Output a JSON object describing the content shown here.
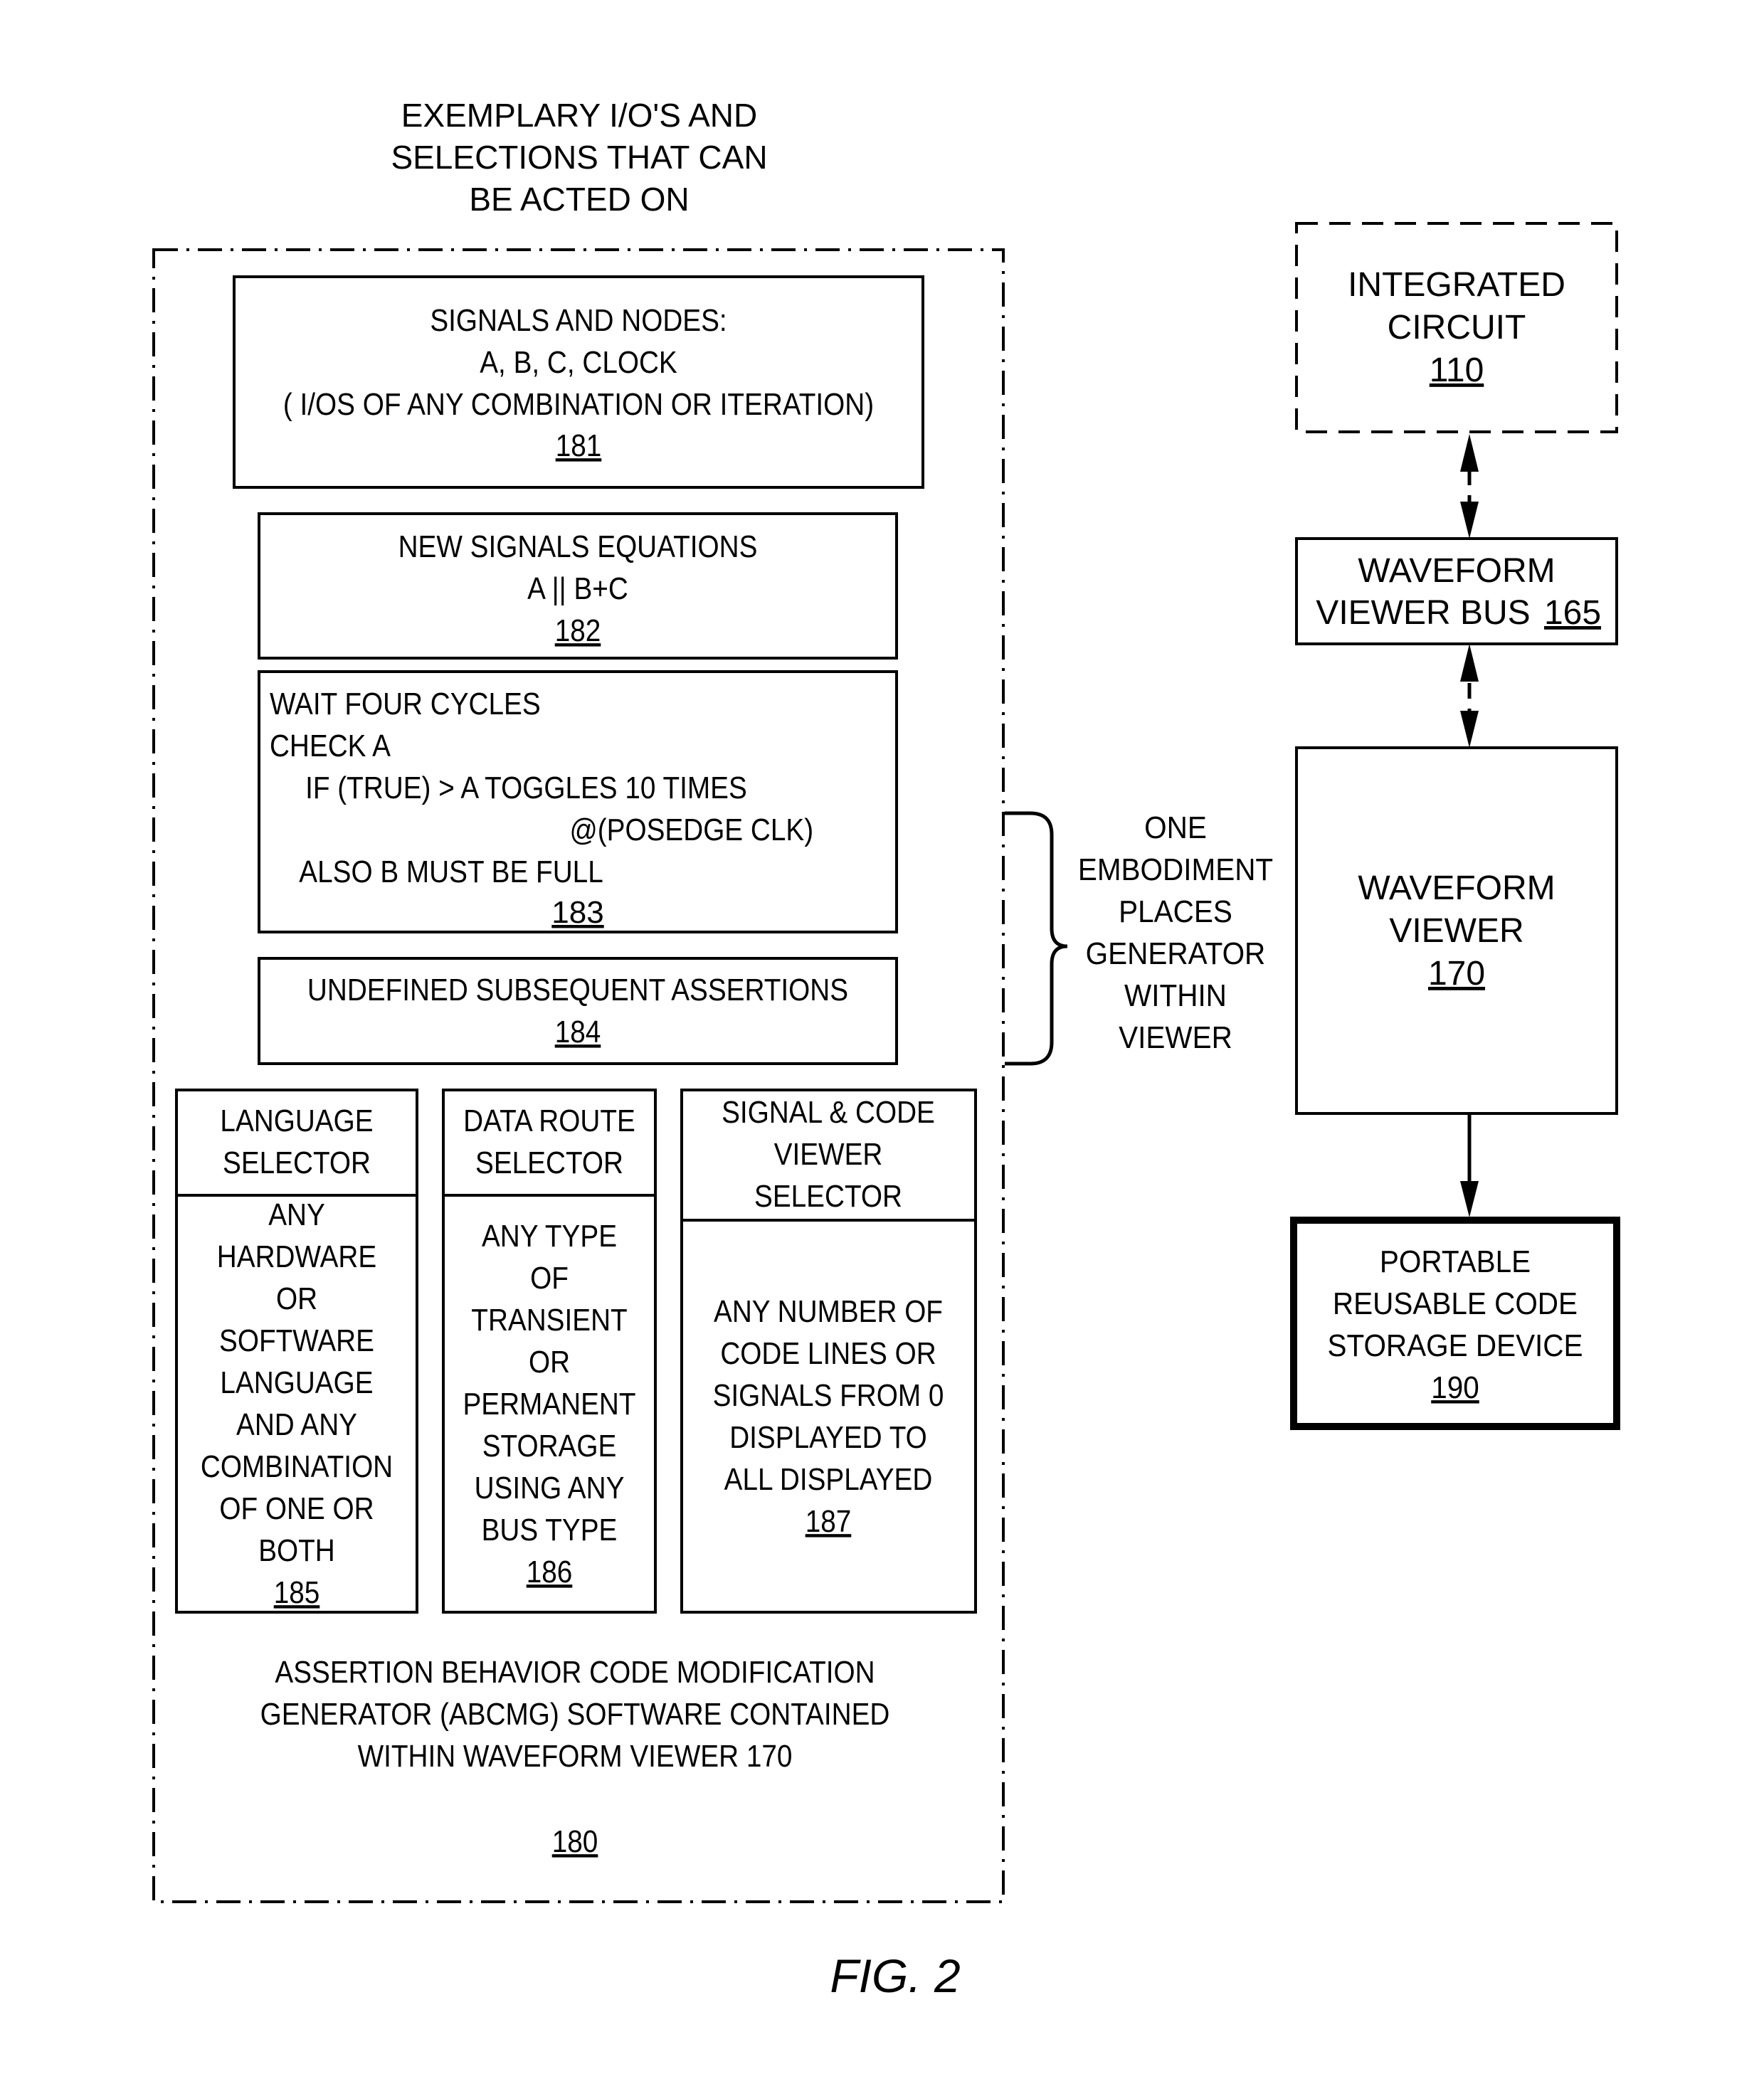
{
  "figure_label": "FIG. 2",
  "header": {
    "lines": [
      "EXEMPLARY I/O'S AND",
      "SELECTIONS THAT CAN",
      "BE ACTED ON"
    ]
  },
  "abcmg": {
    "caption_lines": [
      "ASSERTION BEHAVIOR CODE MODIFICATION",
      "GENERATOR (ABCMG) SOFTWARE CONTAINED",
      "WITHIN WAVEFORM VIEWER 170"
    ],
    "ref": "180"
  },
  "boxes": {
    "signals_nodes": {
      "lines": [
        "SIGNALS AND NODES:",
        "A, B, C, CLOCK",
        "( I/OS OF ANY COMBINATION OR ITERATION)"
      ],
      "ref": "181"
    },
    "new_signals": {
      "lines": [
        "NEW SIGNALS EQUATIONS",
        "A || B+C"
      ],
      "ref": "182"
    },
    "wait_cycles": {
      "lines": [
        "WAIT FOUR CYCLES",
        "CHECK A",
        "IF (TRUE) > A TOGGLES 10 TIMES",
        "@(POSEDGE CLK)",
        "ALSO B MUST BE FULL"
      ],
      "ref": "183"
    },
    "undefined_assertions": {
      "lines": [
        "UNDEFINED SUBSEQUENT ASSERTIONS"
      ],
      "ref": "184"
    },
    "language_selector": {
      "title_lines": [
        "LANGUAGE",
        "SELECTOR"
      ],
      "body_lines": [
        "ANY",
        "HARDWARE",
        "OR",
        "SOFTWARE",
        "LANGUAGE",
        "AND ANY",
        "COMBINATION",
        "OF ONE OR",
        "BOTH"
      ],
      "ref": "185"
    },
    "data_route_selector": {
      "title_lines": [
        "DATA ROUTE",
        "SELECTOR"
      ],
      "body_lines": [
        "ANY TYPE",
        "OF",
        "TRANSIENT",
        "OR",
        "PERMANENT",
        "STORAGE",
        "USING ANY",
        "BUS TYPE"
      ],
      "ref": "186"
    },
    "signal_code_viewer_selector": {
      "title_lines": [
        "SIGNAL & CODE",
        "VIEWER",
        "SELECTOR"
      ],
      "body_lines": [
        "ANY NUMBER OF",
        "CODE LINES OR",
        "SIGNALS FROM 0",
        "DISPLAYED TO",
        "ALL DISPLAYED"
      ],
      "ref": "187"
    }
  },
  "brace_note": {
    "lines": [
      "ONE",
      "EMBODIMENT",
      "PLACES",
      "GENERATOR",
      "WITHIN",
      "VIEWER"
    ]
  },
  "right_column": {
    "integrated_circuit": {
      "lines": [
        "INTEGRATED",
        "CIRCUIT"
      ],
      "ref": "110"
    },
    "waveform_viewer_bus": {
      "lines": [
        "WAVEFORM",
        "VIEWER BUS"
      ],
      "ref": "165"
    },
    "waveform_viewer": {
      "lines": [
        "WAVEFORM",
        "VIEWER"
      ],
      "ref": "170"
    },
    "portable_storage": {
      "lines": [
        "PORTABLE",
        "REUSABLE CODE",
        "STORAGE DEVICE"
      ],
      "ref": "190"
    }
  }
}
